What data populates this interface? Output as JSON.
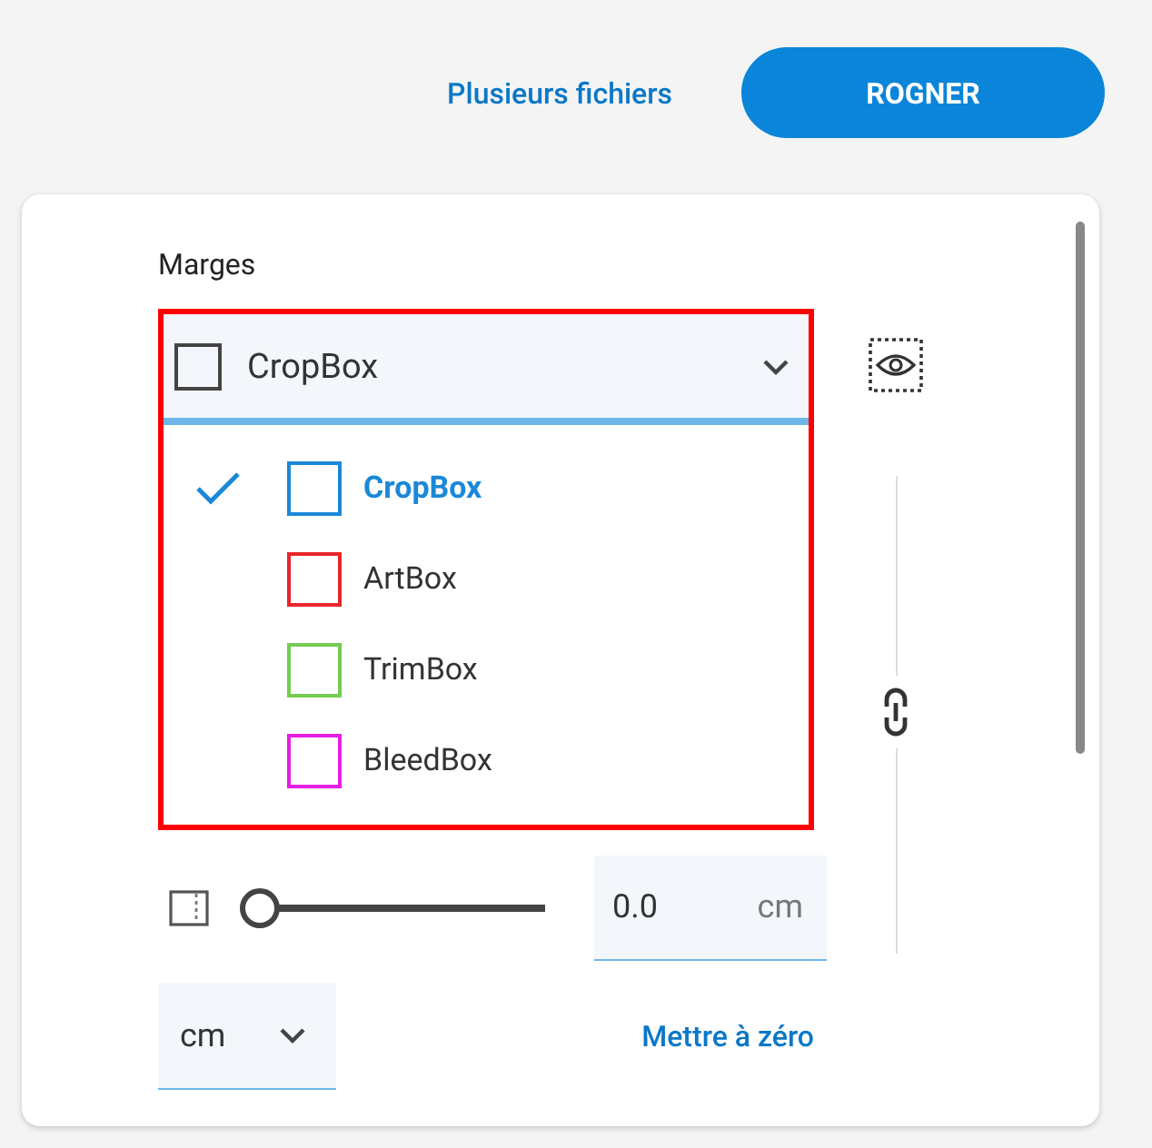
{
  "header": {
    "link": "Plusieurs fichiers",
    "button": "ROGNER"
  },
  "margins": {
    "label": "Marges",
    "dropdown": {
      "value": "CropBox",
      "expanded": true,
      "options": [
        {
          "label": "CropBox",
          "color": "#1a88d8",
          "selected": true
        },
        {
          "label": "ArtBox",
          "color": "#e8262a",
          "selected": false
        },
        {
          "label": "TrimBox",
          "color": "#74cc52",
          "selected": false
        },
        {
          "label": "BleedBox",
          "color": "#e61ee6",
          "selected": false
        }
      ]
    },
    "slider": {
      "level": 0
    },
    "field": {
      "value": "0.0",
      "unit": "cm"
    },
    "unit_select": {
      "value": "cm"
    },
    "reset_link": "Mettre à zéro"
  }
}
